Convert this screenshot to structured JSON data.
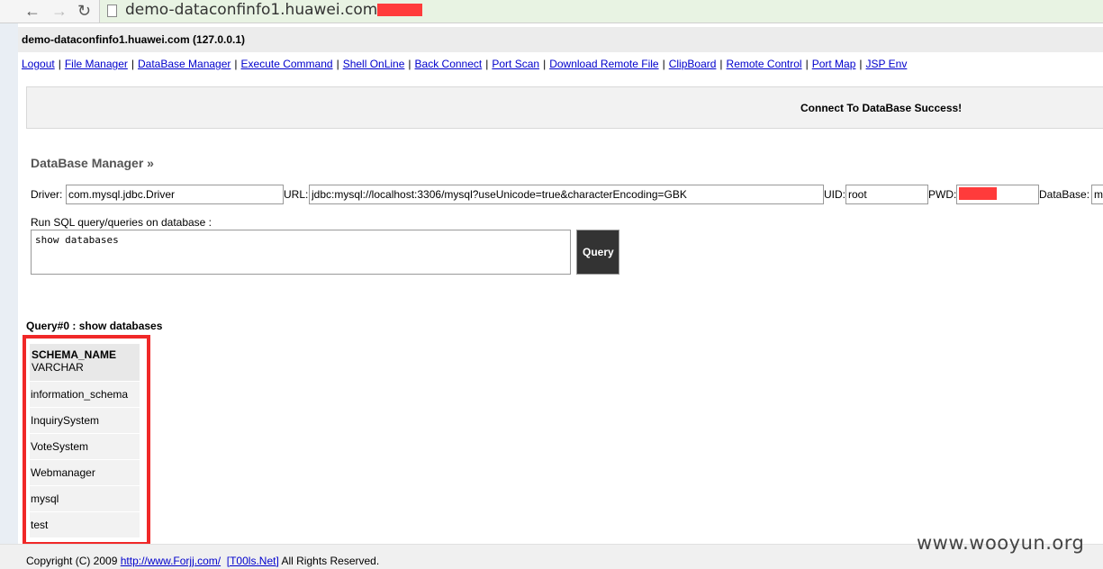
{
  "browser": {
    "back_glyph": "←",
    "forward_glyph": "→",
    "reload_glyph": "↻",
    "url": "demo-dataconfinfo1.huawei.com"
  },
  "host": {
    "label": "demo-dataconfinfo1.huawei.com (127.0.0.1)"
  },
  "menu": [
    "Logout",
    "File Manager",
    "DataBase Manager",
    "Execute Command",
    "Shell OnLine",
    "Back Connect",
    "Port Scan",
    "Download Remote File",
    "ClipBoard",
    "Remote Control",
    "Port Map",
    "JSP Env"
  ],
  "menu_separator": "|",
  "message": "Connect To DataBase Success!",
  "dbmanager": {
    "title": "DataBase Manager »",
    "driver_label": "Driver:",
    "driver_value": "com.mysql.jdbc.Driver",
    "url_label": "URL:",
    "url_value": "jdbc:mysql://localhost:3306/mysql?useUnicode=true&characterEncoding=GBK",
    "uid_label": "UID:",
    "uid_value": "root",
    "pwd_label": "PWD:",
    "pwd_value": "",
    "database_label": "DataBase:",
    "database_value": "m",
    "run_label": "Run SQL query/queries on database :",
    "sql_value": "show databases",
    "query_button": "Query"
  },
  "result": {
    "title": "Query#0 : show databases",
    "column_name": "SCHEMA_NAME",
    "column_type": "VARCHAR",
    "rows": [
      "information_schema",
      "InquirySystem",
      "VoteSystem",
      "Webmanager",
      "mysql",
      "test"
    ]
  },
  "footer": {
    "copyright": "Copyright (C) 2009",
    "link1": "http://www.Forjj.com/",
    "link2": "[T00ls.Net]",
    "rights": "All Rights Reserved."
  },
  "watermark": "www.wooyun.org",
  "colors": {
    "highlight_red": "#f02828",
    "link_blue": "#0000cc",
    "query_button_bg": "#333333"
  }
}
